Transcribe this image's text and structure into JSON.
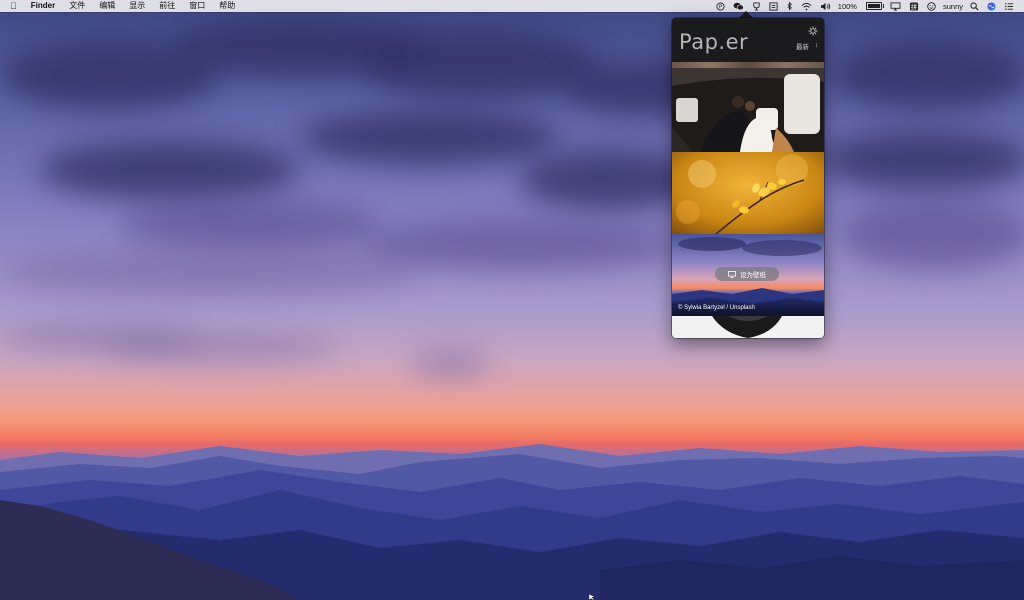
{
  "menubar": {
    "apple_icon": "apple-logo-icon",
    "app_name": "Finder",
    "menus": [
      "文件",
      "编辑",
      "显示",
      "前往",
      "窗口",
      "帮助"
    ],
    "tray_icons": [
      "paper-app-icon",
      "wechat-icon",
      "trophy-icon",
      "list-icon",
      "bluetooth-icon",
      "wifi-icon",
      "volume-icon",
      "battery-icon",
      "airplay-icon",
      "input-source-icon",
      "user-icon",
      "search-icon",
      "siri-icon",
      "notification-center-icon"
    ],
    "battery_percent": "100%",
    "input_source": "拼",
    "user_name": "sunny"
  },
  "paper_app": {
    "logo": "Pap.er",
    "category": "最新",
    "settings_icon": "gear-icon",
    "wallpapers": [
      {
        "subject": "wedding-couple-in-car"
      },
      {
        "subject": "autumn-yellow-leaves"
      },
      {
        "subject": "sunset-over-mountains",
        "hovered": true,
        "action_label": "设为壁纸",
        "credit": "© Sylwia Bartyzel / Unsplash"
      },
      {
        "subject": "partial-next-thumbnail"
      }
    ]
  },
  "colors": {
    "menubar_bg": "#ececf0",
    "popover_bg": "#1b1b1d",
    "sky_top": "#3c4581",
    "sunset_orange": "#f58162"
  }
}
